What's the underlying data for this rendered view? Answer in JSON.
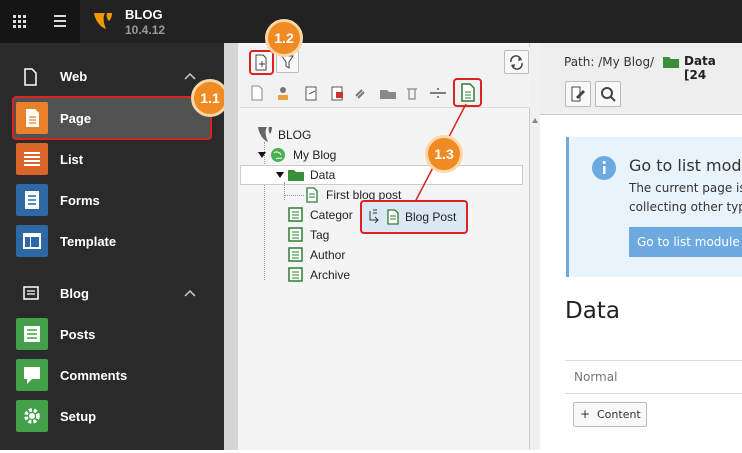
{
  "topbar": {
    "site_name": "BLOG",
    "version": "10.4.12"
  },
  "sidebar": {
    "groups": [
      {
        "title": "Web",
        "items": [
          {
            "label": "Page",
            "color": "#e8812c",
            "active": true
          },
          {
            "label": "List",
            "color": "#d9652a"
          },
          {
            "label": "Forms",
            "color": "#2d6aa5"
          },
          {
            "label": "Template",
            "color": "#2d6aa5"
          }
        ]
      },
      {
        "title": "Blog",
        "items": [
          {
            "label": "Posts",
            "color": "#43a047"
          },
          {
            "label": "Comments",
            "color": "#43a047"
          },
          {
            "label": "Setup",
            "color": "#43a047"
          }
        ]
      }
    ]
  },
  "tree": {
    "root": "BLOG",
    "nodes": [
      "My Blog",
      "Data",
      "First blog post",
      "Categor",
      "Tag",
      "Author",
      "Archive"
    ],
    "drag_label": "Blog Post"
  },
  "content": {
    "path_label": "Path: /My Blog/",
    "path_current": "Data [24",
    "info_title": "Go to list modu",
    "info_text_1": "The current page is",
    "info_text_2": "collecting other typ",
    "list_button": "Go to list module",
    "page_title": "Data",
    "column_label": "Normal",
    "content_button": "Content"
  },
  "callouts": [
    "1.1",
    "1.2",
    "1.3"
  ],
  "colors": {
    "accent": "#f08a23",
    "highlight": "#dd2222"
  }
}
